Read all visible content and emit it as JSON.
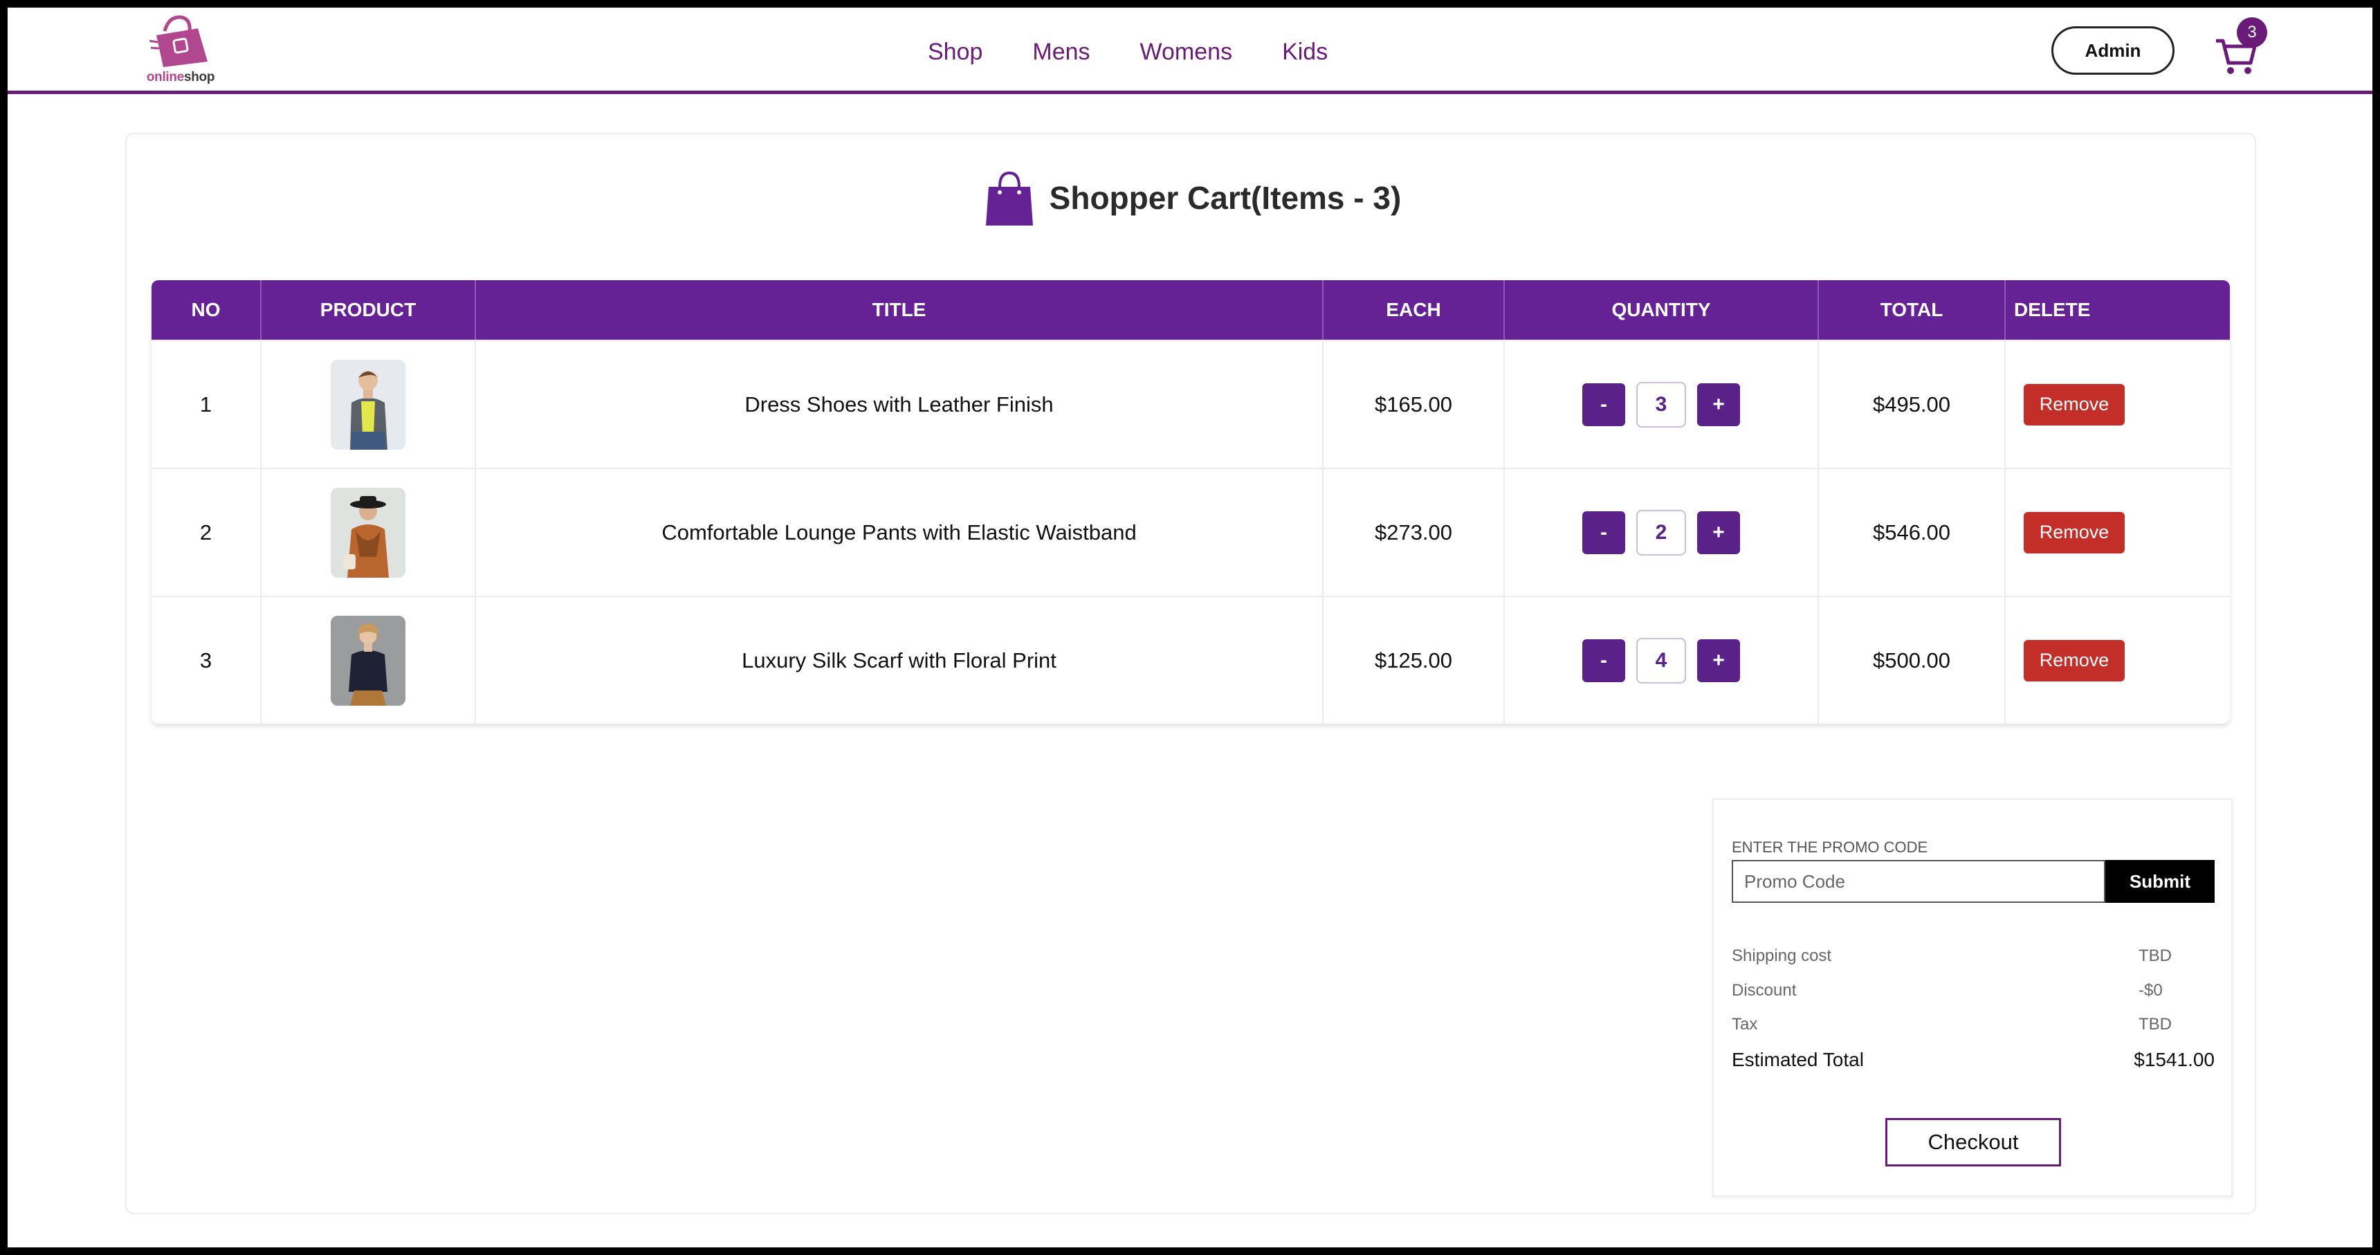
{
  "header": {
    "logo_text_a": "online",
    "logo_text_b": "shop",
    "nav": [
      "Shop",
      "Mens",
      "Womens",
      "Kids"
    ],
    "admin_label": "Admin",
    "cart_count": "3"
  },
  "cart": {
    "title": "Shopper Cart(Items - 3)",
    "columns": [
      "NO",
      "PRODUCT",
      "TITLE",
      "EACH",
      "QUANTITY",
      "TOTAL",
      "DELETE"
    ],
    "rows": [
      {
        "no": "1",
        "title": "Dress Shoes with Leather Finish",
        "each": "$165.00",
        "qty": "3",
        "total": "$495.00",
        "remove": "Remove"
      },
      {
        "no": "2",
        "title": "Comfortable Lounge Pants with Elastic Waistband",
        "each": "$273.00",
        "qty": "2",
        "total": "$546.00",
        "remove": "Remove"
      },
      {
        "no": "3",
        "title": "Luxury Silk Scarf with Floral Print",
        "each": "$125.00",
        "qty": "4",
        "total": "$500.00",
        "remove": "Remove"
      }
    ],
    "minus": "-",
    "plus": "+"
  },
  "summary": {
    "promo_label": "ENTER THE PROMO CODE",
    "promo_placeholder": "Promo Code",
    "submit_label": "Submit",
    "shipping_label": "Shipping cost",
    "shipping_value": "TBD",
    "discount_label": "Discount",
    "discount_value": "-$0",
    "tax_label": "Tax",
    "tax_value": "TBD",
    "total_label": "Estimated Total",
    "total_value": "$1541.00",
    "checkout_label": "Checkout"
  },
  "colors": {
    "brand": "#6a1b7a",
    "table_header": "#642294",
    "remove": "#c42e28"
  }
}
